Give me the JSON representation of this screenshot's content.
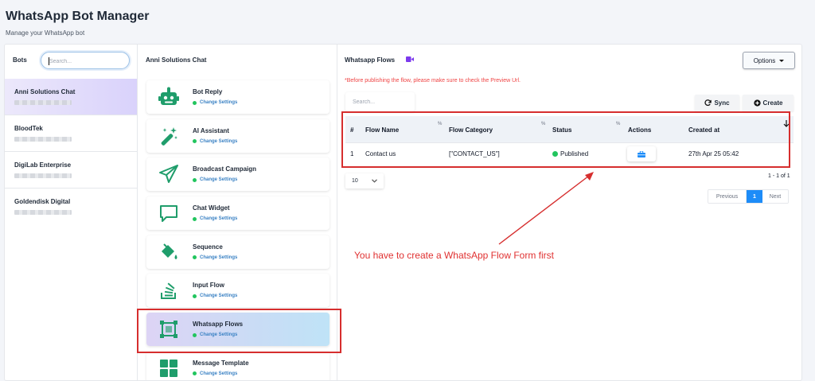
{
  "header": {
    "title": "WhatsApp Bot Manager",
    "subtitle": "Manage your WhatsApp bot"
  },
  "bots": {
    "header": "Bots",
    "search_placeholder": "Search...",
    "items": [
      {
        "name": "Anni Solutions Chat",
        "active": true
      },
      {
        "name": "BloodTek",
        "active": false
      },
      {
        "name": "DigiLab Enterprise",
        "active": false
      },
      {
        "name": "Goldendisk Digital",
        "active": false
      }
    ]
  },
  "menu": {
    "header": "Anni Solutions Chat",
    "sub_label": "Change Settings",
    "items": [
      {
        "label": "Bot Reply",
        "icon": "robot-icon"
      },
      {
        "label": "AI Assistant",
        "icon": "magic-wand-icon"
      },
      {
        "label": "Broadcast Campaign",
        "icon": "paper-plane-icon"
      },
      {
        "label": "Chat Widget",
        "icon": "chat-bubble-icon"
      },
      {
        "label": "Sequence",
        "icon": "paint-bucket-icon"
      },
      {
        "label": "Input Flow",
        "icon": "stack-overflow-icon"
      },
      {
        "label": "Whatsapp Flows",
        "icon": "flow-frame-icon",
        "active": true
      },
      {
        "label": "Message Template",
        "icon": "grid-icon"
      }
    ]
  },
  "main": {
    "title": "Whatsapp Flows",
    "options_label": "Options",
    "warning": "*Before publishing the flow, please make sure to check the Preview Url.",
    "search_placeholder": "Search...",
    "sync_label": "Sync",
    "create_label": "Create",
    "columns": [
      "#",
      "Flow Name",
      "Flow Category",
      "Status",
      "Actions",
      "Created at"
    ],
    "rows": [
      {
        "num": "1",
        "name": "Contact us",
        "category": "[\"CONTACT_US\"]",
        "status": "Published",
        "created": "27th Apr 25 05:42"
      }
    ],
    "page_size": "10",
    "range_text": "1 - 1 of 1",
    "pagination": {
      "prev": "Previous",
      "current": "1",
      "next": "Next"
    }
  },
  "annotation": {
    "text": "You have to create a WhatsApp Flow Form first",
    "color": "#e03131"
  },
  "colors": {
    "accent": "#1d8cf8",
    "success": "#22c55e",
    "link": "#3b82c4",
    "warning": "#ef4444",
    "icon_green": "#1f9d6b"
  }
}
